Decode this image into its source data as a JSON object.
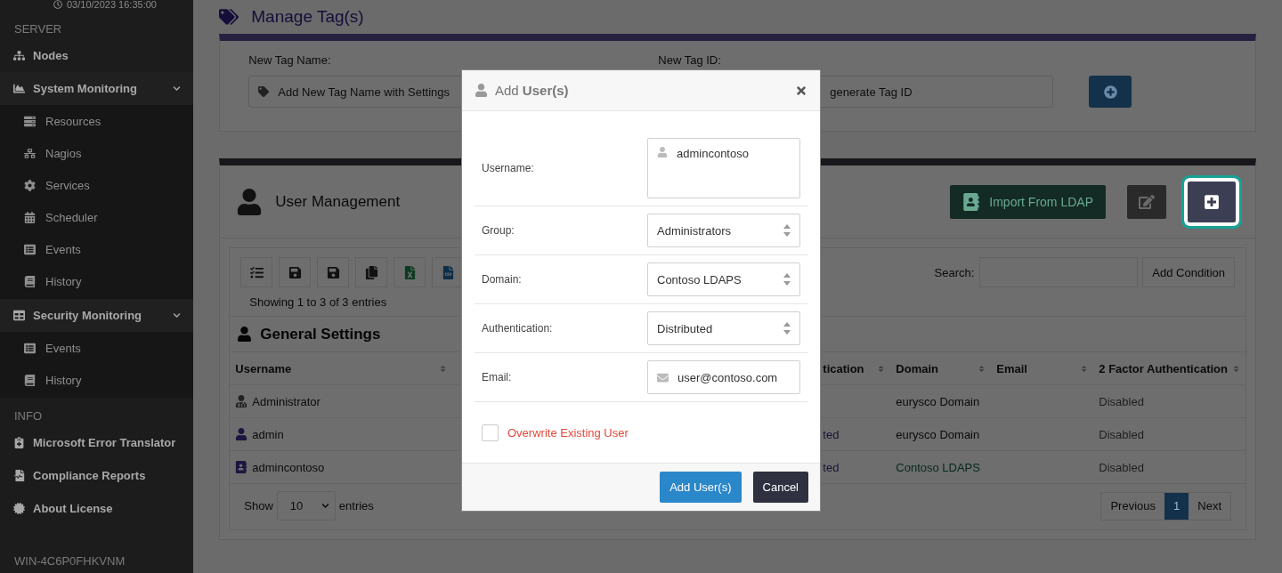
{
  "sidebar": {
    "datetime": "03/10/2023 16:35:00",
    "sections": [
      {
        "title": "SERVER",
        "items": [
          {
            "label": "Nodes"
          },
          {
            "label": "System Monitoring",
            "expanded": true,
            "children": [
              {
                "label": "Resources"
              },
              {
                "label": "Nagios"
              },
              {
                "label": "Services"
              },
              {
                "label": "Scheduler"
              },
              {
                "label": "Events"
              },
              {
                "label": "History"
              }
            ]
          },
          {
            "label": "Security Monitoring",
            "expanded": true,
            "children": [
              {
                "label": "Events"
              },
              {
                "label": "History"
              }
            ]
          }
        ]
      },
      {
        "title": "INFO",
        "items": [
          {
            "label": "Microsoft Error Translator"
          },
          {
            "label": "Compliance Reports"
          },
          {
            "label": "About License"
          }
        ]
      }
    ],
    "hostname": "WIN-4C6P0FHKVNM"
  },
  "manage_tags": {
    "title": "Manage Tag(s)",
    "name_label": "New Tag Name:",
    "name_placeholder": "Add New Tag Name with Settings",
    "id_label": "New Tag ID:",
    "id_placeholder": "generate Tag ID"
  },
  "user_management": {
    "title": "User Management",
    "import_button": "Import From LDAP",
    "search_label": "Search:",
    "add_condition": "Add Condition",
    "showing": "Showing 1 to 3 of 3 entries",
    "section_title": "General Settings",
    "columns": [
      "Username",
      "tication",
      "Domain",
      "Email",
      "2 Factor Authentication"
    ],
    "rows": [
      {
        "kind": "local",
        "username": "Administrator",
        "domain": "eurysco Domain",
        "domain_link": false,
        "two_factor": "Disabled"
      },
      {
        "kind": "user",
        "username": "admin",
        "auth": "ted",
        "domain": "eurysco Domain",
        "domain_link": false,
        "two_factor": "Disabled"
      },
      {
        "kind": "ldap",
        "username": "admincontoso",
        "auth": "ted",
        "domain": "Contoso LDAPS",
        "domain_link": true,
        "two_factor": "Disabled"
      }
    ],
    "show_label": "Show",
    "page_size": "10",
    "entries_label": "entries",
    "pagination": [
      {
        "label": "Previous",
        "selected": false
      },
      {
        "label": "1",
        "selected": true
      },
      {
        "label": "Next",
        "selected": false
      }
    ]
  },
  "dialog": {
    "title": "Add **User(s)**",
    "fields": [
      {
        "kind": "textarea",
        "label": "Username:",
        "value": "admincontoso"
      },
      {
        "kind": "select",
        "label": "Group:",
        "value": "Administrators"
      },
      {
        "kind": "select",
        "label": "Domain:",
        "value": "Contoso LDAPS"
      },
      {
        "kind": "select",
        "label": "Authentication:",
        "value": "Distributed"
      },
      {
        "kind": "email",
        "label": "Email:",
        "value": "user@contoso.com"
      }
    ],
    "overwrite": {
      "label": "Overwrite Existing User",
      "checked": false
    },
    "buttons": [
      {
        "kind": "primary",
        "label": "Add User(s)"
      },
      {
        "kind": "secondary",
        "label": "Cancel"
      }
    ]
  }
}
